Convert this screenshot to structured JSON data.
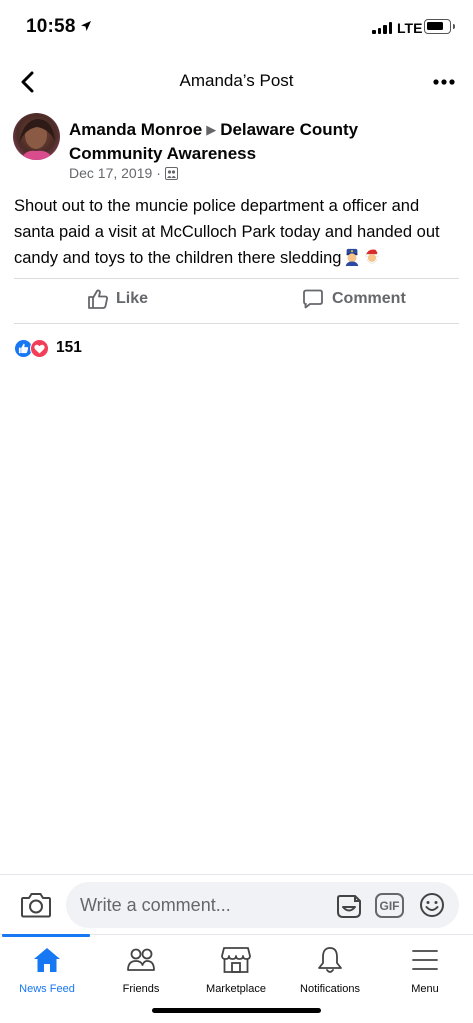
{
  "status_bar": {
    "time": "10:58",
    "network": "LTE"
  },
  "header": {
    "title": "Amanda’s Post"
  },
  "post": {
    "author": "Amanda Monroe",
    "group": "Delaware County Community Awareness",
    "date": "Dec 17, 2019",
    "meta_separator": "·",
    "body": "Shout out to the muncie police department a officer and santa paid a visit at McCulloch Park today and handed out candy and toys to the children there sledding",
    "emojis": [
      "police-officer-emoji",
      "santa-emoji"
    ]
  },
  "actions": {
    "like_label": "Like",
    "comment_label": "Comment"
  },
  "reactions": {
    "count": "151",
    "types": [
      "like",
      "love"
    ]
  },
  "composer": {
    "placeholder": "Write a comment...",
    "gif_label": "GIF"
  },
  "tabs": [
    {
      "label": "News Feed",
      "icon": "home-icon",
      "active": true
    },
    {
      "label": "Friends",
      "icon": "friends-icon",
      "active": false
    },
    {
      "label": "Marketplace",
      "icon": "marketplace-icon",
      "active": false
    },
    {
      "label": "Notifications",
      "icon": "bell-icon",
      "active": false
    },
    {
      "label": "Menu",
      "icon": "menu-icon",
      "active": false
    }
  ],
  "colors": {
    "accent": "#1877f2",
    "secondary_text": "#65676b",
    "love": "#f33e58"
  }
}
